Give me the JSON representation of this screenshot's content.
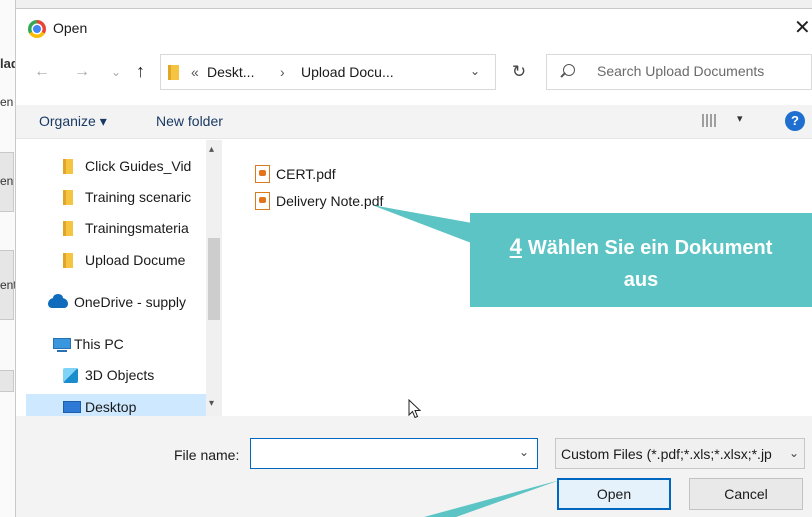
{
  "background": {
    "fragments": [
      "lad",
      "en",
      "en",
      "ent"
    ]
  },
  "dialog": {
    "title": "Open",
    "close_glyph": "✕"
  },
  "address": {
    "back_glyph": "←",
    "forward_glyph": "→",
    "recent_glyph": "⌄",
    "up_glyph": "↑",
    "overflow": "«",
    "crumbs": [
      "Deskt...",
      "Upload Docu..."
    ],
    "separator": "›",
    "dropdown_glyph": "⌄",
    "refresh_glyph": "↻"
  },
  "search": {
    "placeholder": "Search Upload Documents"
  },
  "toolbar": {
    "organize": "Organize ▾",
    "new_folder": "New folder",
    "view_dd": "▾",
    "help": "?"
  },
  "nav_pane": {
    "items": [
      {
        "label": "Click Guides_Vid",
        "icon": "folder-icon"
      },
      {
        "label": "Training scenaric",
        "icon": "folder-icon"
      },
      {
        "label": "Trainingsmateria",
        "icon": "folder-icon"
      },
      {
        "label": "Upload Docume",
        "icon": "folder-icon"
      },
      {
        "label": "OneDrive - supply",
        "icon": "onedrive-icon"
      },
      {
        "label": "This PC",
        "icon": "pc-icon"
      },
      {
        "label": "3D Objects",
        "icon": "3d-objects-icon"
      },
      {
        "label": "Desktop",
        "icon": "desktop-icon",
        "selected": true
      }
    ],
    "scroll_up": "▴",
    "scroll_down": "▾"
  },
  "files": [
    {
      "name": "CERT.pdf",
      "icon": "pdf-icon"
    },
    {
      "name": "Delivery Note.pdf",
      "icon": "pdf-icon"
    }
  ],
  "bottom": {
    "file_name_label": "File name:",
    "file_name_value": "",
    "file_name_dd": "⌄",
    "file_type": "Custom Files (*.pdf;*.xls;*.xlsx;*.jp",
    "file_type_dd": "⌄",
    "open": "Open",
    "cancel": "Cancel"
  },
  "callout": {
    "step": "4",
    "line1": "Wählen Sie ein Dokument",
    "line2": "aus",
    "color": "#5cc4c4"
  }
}
